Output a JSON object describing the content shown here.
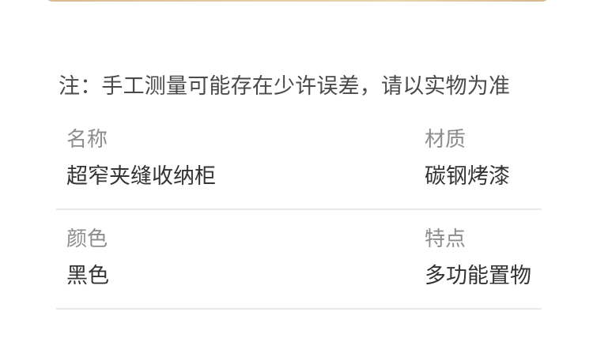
{
  "note": "注：手工测量可能存在少许误差，请以实物为准",
  "specs": [
    {
      "label": "名称",
      "value": "超窄夹缝收纳柜"
    },
    {
      "label": "材质",
      "value": "碳钢烤漆"
    },
    {
      "label": "颜色",
      "value": "黑色"
    },
    {
      "label": "特点",
      "value": "多功能置物"
    }
  ]
}
